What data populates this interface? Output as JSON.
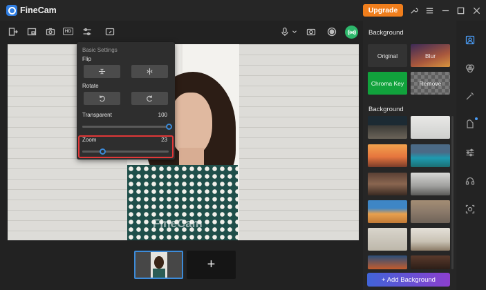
{
  "app": {
    "name": "FineCam",
    "upgrade_label": "Upgrade"
  },
  "titlebar": {
    "icons": [
      "wrench-icon",
      "menu-icon",
      "minimize-icon",
      "maximize-icon",
      "close-icon"
    ]
  },
  "toolbar": {
    "hd_label": "HD",
    "icons": [
      "exit-presentation-icon",
      "picture-in-picture-icon",
      "camera-switch-icon",
      "hd-icon",
      "settings-sliders-icon",
      "whiteboard-icon",
      "microphone-icon",
      "chevron-down-icon",
      "snapshot-icon",
      "record-icon",
      "live-broadcast-icon"
    ]
  },
  "preview": {
    "watermark": "FineCam"
  },
  "basic_settings": {
    "title": "Basic Settings",
    "flip_label": "Flip",
    "rotate_label": "Rotate",
    "transparent": {
      "label": "Transparent",
      "value": "100",
      "level": 1.0
    },
    "zoom": {
      "label": "Zoom",
      "value": "23",
      "level": 0.23
    }
  },
  "background_panel": {
    "title": "Background",
    "options": [
      {
        "label": "Original"
      },
      {
        "label": "Blur"
      },
      {
        "label": "Chroma Key"
      },
      {
        "label": "Remove"
      }
    ],
    "gallery_title": "Background",
    "add_label": "+ Add Background"
  },
  "thumbnails": {
    "add_label": "+"
  },
  "colors": {
    "accent": "#3c8bd9",
    "upgrade": "#f07e1c",
    "chroma": "#11a23c",
    "live": "#2db76b",
    "highlight": "#e23838"
  },
  "rail": {
    "icons": [
      "person-background-icon",
      "filters-icon",
      "magic-wand-icon",
      "sticker-icon",
      "adjust-sliders-icon",
      "headset-icon",
      "face-scan-icon"
    ]
  }
}
